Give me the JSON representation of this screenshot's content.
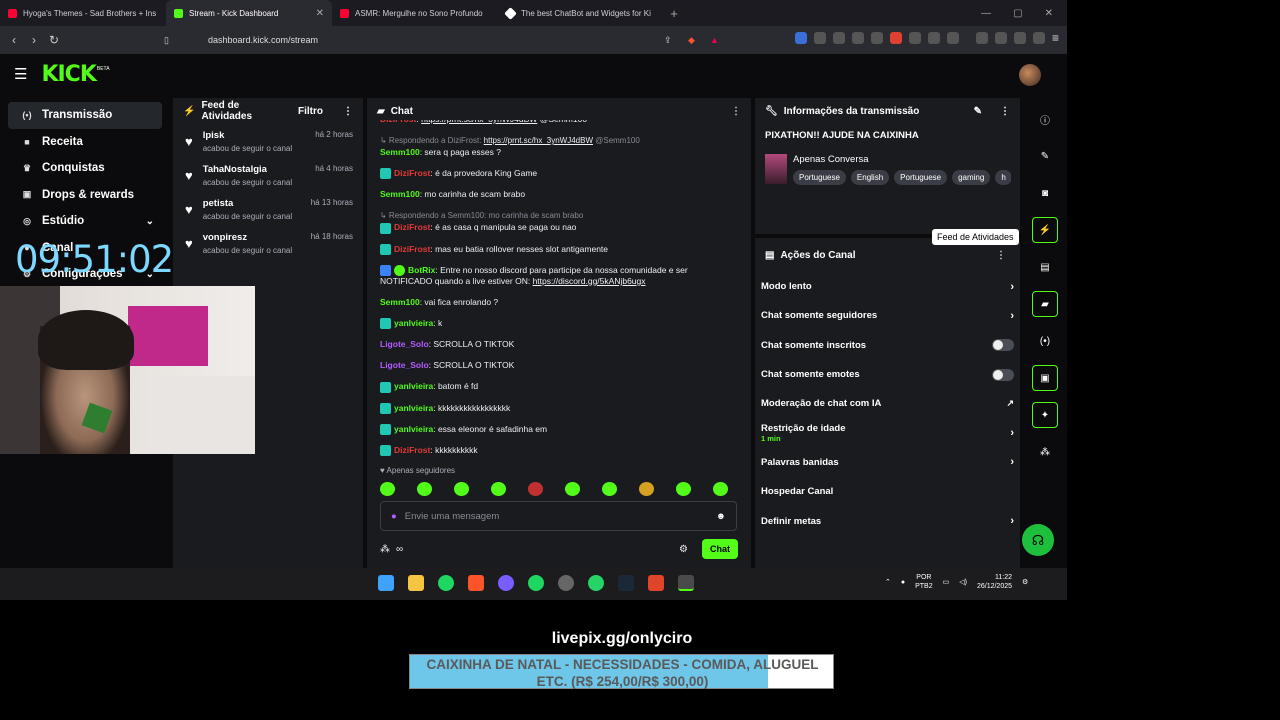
{
  "browser": {
    "tabs": [
      {
        "title": "Hyoga's Themes - Sad Brothers + Ins",
        "color": "#ff0033"
      },
      {
        "title": "Stream - Kick Dashboard",
        "color": "#53fc18"
      },
      {
        "title": "ASMR: Mergulhe no Sono Profundo",
        "color": "#ff0033"
      },
      {
        "title": "The best ChatBot and Widgets for Ki",
        "color": "#ffffff"
      }
    ],
    "url": "dashboard.kick.com/stream"
  },
  "kick": {
    "logo": "KICK",
    "beta": "BETA",
    "sidebar": [
      {
        "label": "Transmissão",
        "icon": "broadcast-icon"
      },
      {
        "label": "Receita",
        "icon": "money-icon"
      },
      {
        "label": "Conquistas",
        "icon": "trophy-icon"
      },
      {
        "label": "Drops & rewards",
        "icon": "gift-icon"
      },
      {
        "label": "Estúdio",
        "icon": "camera-icon"
      },
      {
        "label": "Canal",
        "icon": "user-icon"
      },
      {
        "label": "Configurações",
        "icon": "gear-icon"
      }
    ],
    "clock": "09:51:02",
    "feed": {
      "title": "Feed de Atividades",
      "filter": "Filtro",
      "items": [
        {
          "name": "lpisk",
          "action": "acabou de seguir o canal",
          "time": "há 2 horas"
        },
        {
          "name": "TahaNostalgia",
          "action": "acabou de seguir o canal",
          "time": "há 4 horas"
        },
        {
          "name": "petista",
          "action": "acabou de seguir o canal",
          "time": "há 13 horas"
        },
        {
          "name": "vonpiresz",
          "action": "acabou de seguir o canal",
          "time": "há 18 horas"
        }
      ]
    },
    "chat": {
      "title": "Chat",
      "followers_only": "Apenas seguidores",
      "placeholder": "Envie uma mensagem",
      "send": "Chat"
    },
    "info": {
      "title": "Informações da transmissão",
      "stream_title": "PIXATHON!! AJUDE NA CAIXINHA",
      "category": "Apenas Conversa",
      "tags": [
        "Portuguese",
        "English",
        "Portuguese",
        "gaming",
        "h"
      ]
    },
    "actions": {
      "title": "Ações do Canal",
      "tooltip": "Feed de Atividades",
      "rows": [
        {
          "label": "Modo lento",
          "control": "chevron"
        },
        {
          "label": "Chat somente seguidores",
          "control": "chevron"
        },
        {
          "label": "Chat somente inscritos",
          "control": "toggle"
        },
        {
          "label": "Chat somente emotes",
          "control": "toggle"
        },
        {
          "label": "Moderação de chat com IA",
          "control": "external"
        },
        {
          "label": "Restrição de idade",
          "sub": "1 min",
          "control": "chevron"
        },
        {
          "label": "Palavras banidas",
          "control": "chevron"
        },
        {
          "label": "Hospedar Canal",
          "control": "none"
        },
        {
          "label": "Definir metas",
          "control": "chevron"
        }
      ]
    }
  },
  "taskbar": {
    "lang": "POR",
    "layout": "PTB2",
    "time": "11:22",
    "date": "26/12/2025"
  },
  "overlay": {
    "url": "livepix.gg/onlyciro",
    "goal_line1": "CAIXINHA DE NATAL - NECESSIDADES - COMIDA, ALUGUEL",
    "goal_line2": "ETC. (R$ 254,00/R$ 300,00)",
    "goal_progress": 0.847
  }
}
